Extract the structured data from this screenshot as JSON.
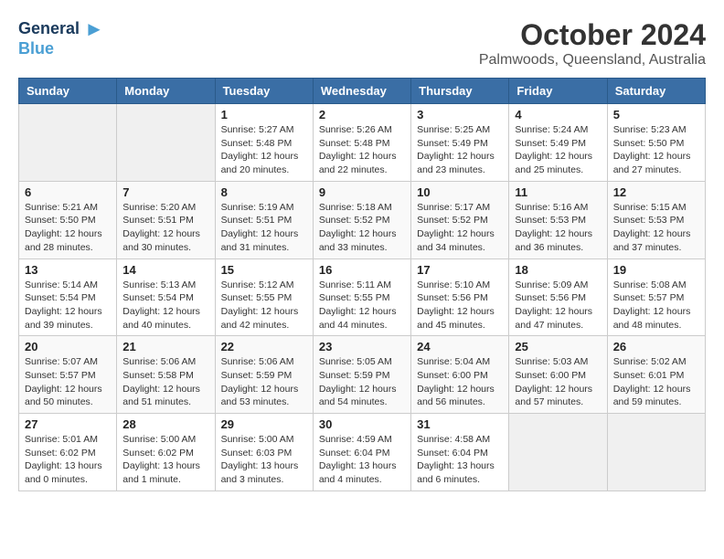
{
  "header": {
    "logo_line1": "General",
    "logo_line2": "Blue",
    "month_title": "October 2024",
    "location": "Palmwoods, Queensland, Australia"
  },
  "weekdays": [
    "Sunday",
    "Monday",
    "Tuesday",
    "Wednesday",
    "Thursday",
    "Friday",
    "Saturday"
  ],
  "weeks": [
    [
      {
        "day": "",
        "info": ""
      },
      {
        "day": "",
        "info": ""
      },
      {
        "day": "1",
        "info": "Sunrise: 5:27 AM\nSunset: 5:48 PM\nDaylight: 12 hours\nand 20 minutes."
      },
      {
        "day": "2",
        "info": "Sunrise: 5:26 AM\nSunset: 5:48 PM\nDaylight: 12 hours\nand 22 minutes."
      },
      {
        "day": "3",
        "info": "Sunrise: 5:25 AM\nSunset: 5:49 PM\nDaylight: 12 hours\nand 23 minutes."
      },
      {
        "day": "4",
        "info": "Sunrise: 5:24 AM\nSunset: 5:49 PM\nDaylight: 12 hours\nand 25 minutes."
      },
      {
        "day": "5",
        "info": "Sunrise: 5:23 AM\nSunset: 5:50 PM\nDaylight: 12 hours\nand 27 minutes."
      }
    ],
    [
      {
        "day": "6",
        "info": "Sunrise: 5:21 AM\nSunset: 5:50 PM\nDaylight: 12 hours\nand 28 minutes."
      },
      {
        "day": "7",
        "info": "Sunrise: 5:20 AM\nSunset: 5:51 PM\nDaylight: 12 hours\nand 30 minutes."
      },
      {
        "day": "8",
        "info": "Sunrise: 5:19 AM\nSunset: 5:51 PM\nDaylight: 12 hours\nand 31 minutes."
      },
      {
        "day": "9",
        "info": "Sunrise: 5:18 AM\nSunset: 5:52 PM\nDaylight: 12 hours\nand 33 minutes."
      },
      {
        "day": "10",
        "info": "Sunrise: 5:17 AM\nSunset: 5:52 PM\nDaylight: 12 hours\nand 34 minutes."
      },
      {
        "day": "11",
        "info": "Sunrise: 5:16 AM\nSunset: 5:53 PM\nDaylight: 12 hours\nand 36 minutes."
      },
      {
        "day": "12",
        "info": "Sunrise: 5:15 AM\nSunset: 5:53 PM\nDaylight: 12 hours\nand 37 minutes."
      }
    ],
    [
      {
        "day": "13",
        "info": "Sunrise: 5:14 AM\nSunset: 5:54 PM\nDaylight: 12 hours\nand 39 minutes."
      },
      {
        "day": "14",
        "info": "Sunrise: 5:13 AM\nSunset: 5:54 PM\nDaylight: 12 hours\nand 40 minutes."
      },
      {
        "day": "15",
        "info": "Sunrise: 5:12 AM\nSunset: 5:55 PM\nDaylight: 12 hours\nand 42 minutes."
      },
      {
        "day": "16",
        "info": "Sunrise: 5:11 AM\nSunset: 5:55 PM\nDaylight: 12 hours\nand 44 minutes."
      },
      {
        "day": "17",
        "info": "Sunrise: 5:10 AM\nSunset: 5:56 PM\nDaylight: 12 hours\nand 45 minutes."
      },
      {
        "day": "18",
        "info": "Sunrise: 5:09 AM\nSunset: 5:56 PM\nDaylight: 12 hours\nand 47 minutes."
      },
      {
        "day": "19",
        "info": "Sunrise: 5:08 AM\nSunset: 5:57 PM\nDaylight: 12 hours\nand 48 minutes."
      }
    ],
    [
      {
        "day": "20",
        "info": "Sunrise: 5:07 AM\nSunset: 5:57 PM\nDaylight: 12 hours\nand 50 minutes."
      },
      {
        "day": "21",
        "info": "Sunrise: 5:06 AM\nSunset: 5:58 PM\nDaylight: 12 hours\nand 51 minutes."
      },
      {
        "day": "22",
        "info": "Sunrise: 5:06 AM\nSunset: 5:59 PM\nDaylight: 12 hours\nand 53 minutes."
      },
      {
        "day": "23",
        "info": "Sunrise: 5:05 AM\nSunset: 5:59 PM\nDaylight: 12 hours\nand 54 minutes."
      },
      {
        "day": "24",
        "info": "Sunrise: 5:04 AM\nSunset: 6:00 PM\nDaylight: 12 hours\nand 56 minutes."
      },
      {
        "day": "25",
        "info": "Sunrise: 5:03 AM\nSunset: 6:00 PM\nDaylight: 12 hours\nand 57 minutes."
      },
      {
        "day": "26",
        "info": "Sunrise: 5:02 AM\nSunset: 6:01 PM\nDaylight: 12 hours\nand 59 minutes."
      }
    ],
    [
      {
        "day": "27",
        "info": "Sunrise: 5:01 AM\nSunset: 6:02 PM\nDaylight: 13 hours\nand 0 minutes."
      },
      {
        "day": "28",
        "info": "Sunrise: 5:00 AM\nSunset: 6:02 PM\nDaylight: 13 hours\nand 1 minute."
      },
      {
        "day": "29",
        "info": "Sunrise: 5:00 AM\nSunset: 6:03 PM\nDaylight: 13 hours\nand 3 minutes."
      },
      {
        "day": "30",
        "info": "Sunrise: 4:59 AM\nSunset: 6:04 PM\nDaylight: 13 hours\nand 4 minutes."
      },
      {
        "day": "31",
        "info": "Sunrise: 4:58 AM\nSunset: 6:04 PM\nDaylight: 13 hours\nand 6 minutes."
      },
      {
        "day": "",
        "info": ""
      },
      {
        "day": "",
        "info": ""
      }
    ]
  ]
}
